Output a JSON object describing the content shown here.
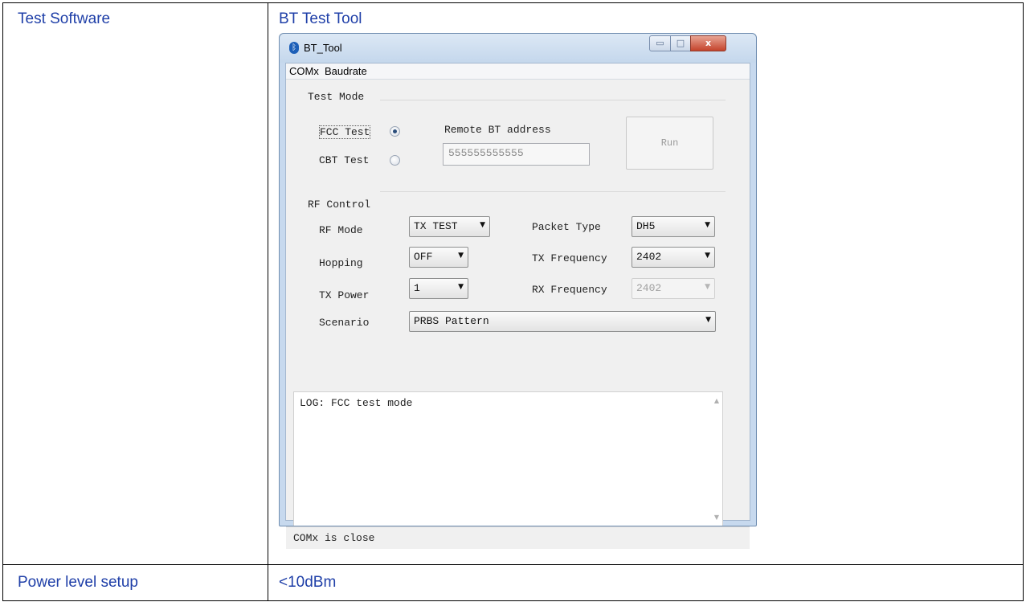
{
  "table": {
    "row1_label": "Test Software",
    "row1_value": "BT Test Tool",
    "row2_label": "Power level setup",
    "row2_value": "<10dBm"
  },
  "window": {
    "title": "BT_Tool",
    "icon": "bluetooth-icon",
    "controls": {
      "minimize": "▭",
      "maximize": "□",
      "close": "x"
    }
  },
  "menu": [
    "COMx",
    "Baudrate"
  ],
  "test_mode": {
    "group_label": "Test Mode",
    "fcc_label": "FCC Test",
    "fcc_selected": true,
    "cbt_label": "CBT Test",
    "cbt_selected": false,
    "remote_label": "Remote BT address",
    "remote_value": "555555555555",
    "run_label": "Run"
  },
  "rf_control": {
    "group_label": "RF Control",
    "rf_mode_label": "RF Mode",
    "rf_mode_value": "TX TEST",
    "hopping_label": "Hopping",
    "hopping_value": "OFF",
    "tx_power_label": "TX Power",
    "tx_power_value": "1",
    "scenario_label": "Scenario",
    "scenario_value": "PRBS Pattern",
    "packet_type_label": "Packet Type",
    "packet_type_value": "DH5",
    "tx_freq_label": "TX Frequency",
    "tx_freq_value": "2402",
    "rx_freq_label": "RX Frequency",
    "rx_freq_value": "2402"
  },
  "log": {
    "text": "LOG: FCC test mode"
  },
  "status": {
    "text": "COMx is close"
  },
  "colors": {
    "doc_text": "#1f3fa8",
    "window_frame": "#c7d9ee",
    "close_button": "#c4442c"
  }
}
